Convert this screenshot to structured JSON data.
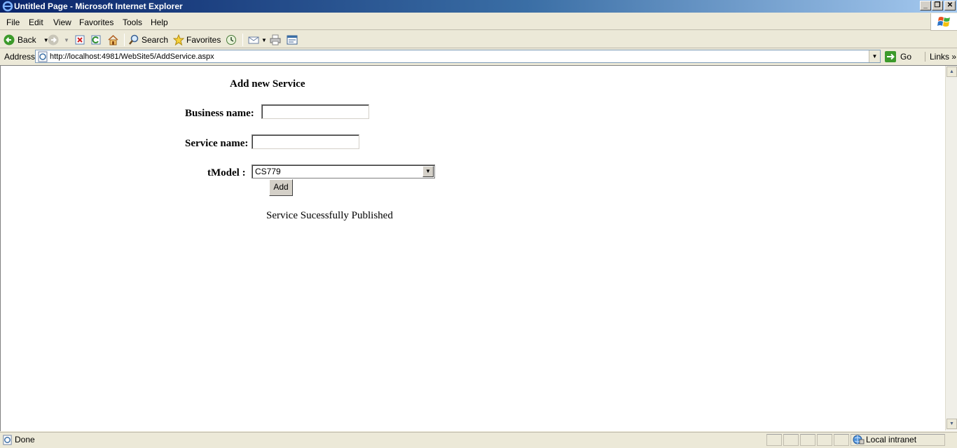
{
  "window": {
    "title": "Untitled Page - Microsoft Internet Explorer",
    "min_glyph": "_",
    "restore_glyph": "❐",
    "close_glyph": "✕"
  },
  "menu": {
    "items": [
      "File",
      "Edit",
      "View",
      "Favorites",
      "Tools",
      "Help"
    ]
  },
  "toolbar": {
    "back_label": "Back",
    "search_label": "Search",
    "favorites_label": "Favorites"
  },
  "address": {
    "label": "Address",
    "url": "http://localhost:4981/WebSite5/AddService.aspx",
    "go_label": "Go",
    "links_label": "Links"
  },
  "page": {
    "title": "Add new Service",
    "business_label": "Business name:",
    "business_value": "",
    "service_label": "Service name:",
    "service_value": "",
    "tmodel_label": "tModel :",
    "tmodel_selected": "CS779",
    "add_button_label": "Add",
    "status_message": "Service Sucessfully Published"
  },
  "statusbar": {
    "status_text": "Done",
    "zone_text": "Local intranet"
  },
  "colors": {
    "titlebar_start": "#0a246a",
    "titlebar_end": "#a6caf0",
    "chrome": "#ece9d8"
  }
}
